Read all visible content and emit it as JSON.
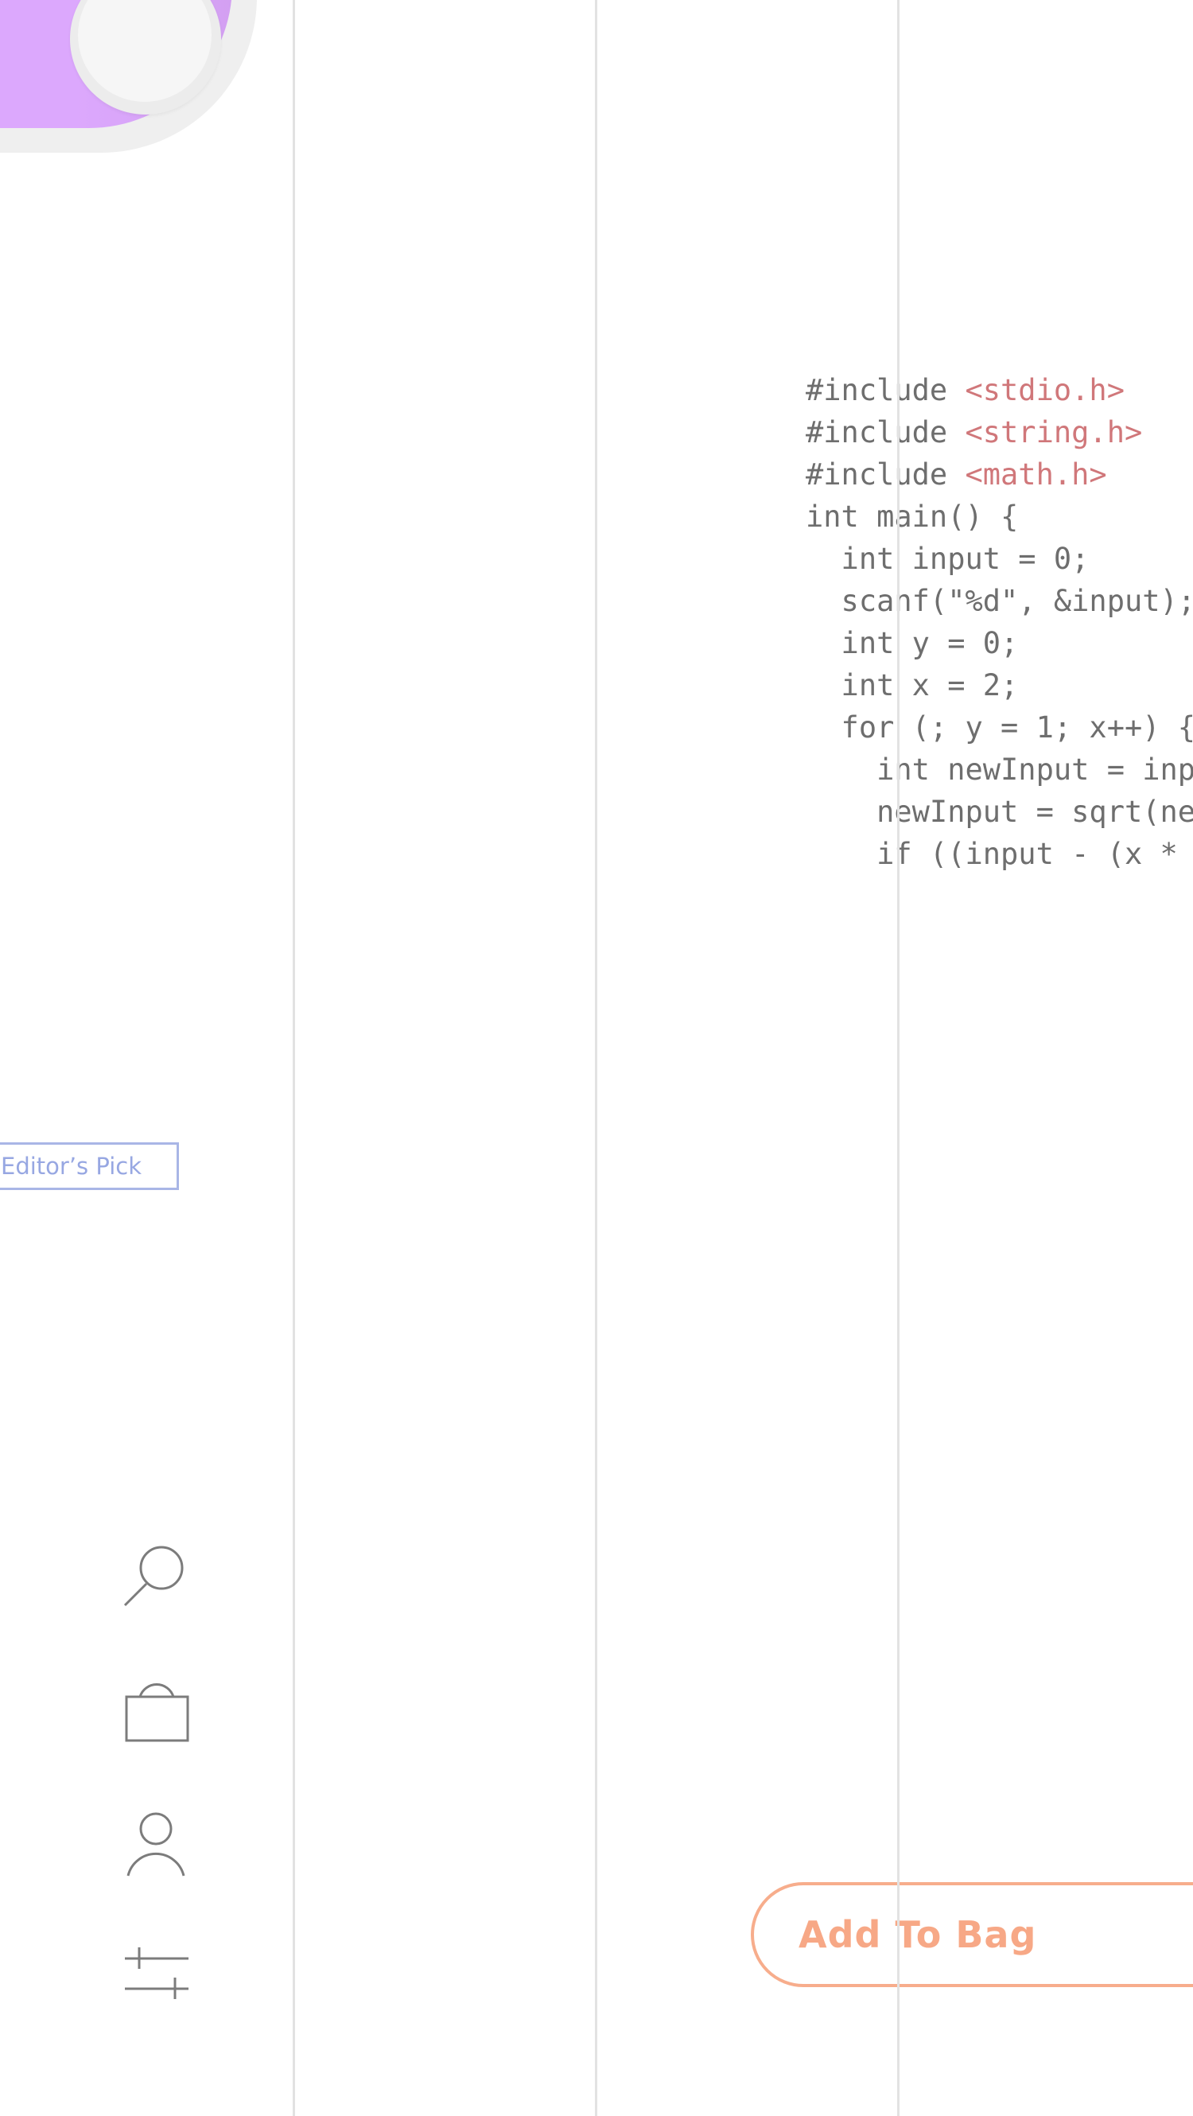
{
  "toggle": {
    "state": "on",
    "accent_color": "#dca8fd"
  },
  "badge": {
    "label": "Editor’s Pick",
    "color": "#97a7e2"
  },
  "nav_icons": [
    {
      "name": "search-icon"
    },
    {
      "name": "bag-icon"
    },
    {
      "name": "user-icon"
    },
    {
      "name": "filter-sliders-icon"
    }
  ],
  "code": {
    "language": "C",
    "lines": [
      {
        "plain": "#include ",
        "str": "<stdio.h>"
      },
      {
        "plain": "#include ",
        "str": "<string.h>"
      },
      {
        "plain": "#include ",
        "str": "<math.h>"
      },
      {
        "plain": "int main() {",
        "str": ""
      },
      {
        "plain": "  int input = 0;",
        "str": ""
      },
      {
        "plain": "  scanf(\"%d\", &input);",
        "str": ""
      },
      {
        "plain": "  int y = 0;",
        "str": ""
      },
      {
        "plain": "  int x = 2;",
        "str": ""
      },
      {
        "plain": "  for (; y = 1; x++) {",
        "str": ""
      },
      {
        "plain": "    int newInput = inp",
        "str": ""
      },
      {
        "plain": "    newInput = sqrt(ne",
        "str": ""
      },
      {
        "plain": "    if ((input - (x * ",
        "str": ""
      }
    ]
  },
  "add_to_bag": {
    "label": "Add To Bag",
    "color": "#f7ad8c"
  }
}
